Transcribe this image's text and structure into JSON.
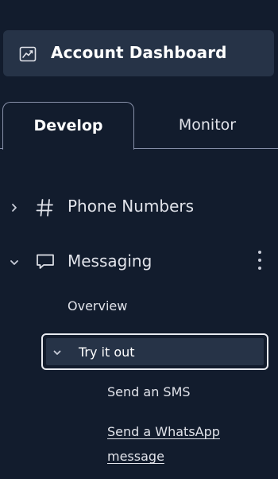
{
  "header": {
    "dashboard_label": "Account Dashboard",
    "dashboard_icon": "chart-line-icon"
  },
  "tabs": [
    {
      "label": "Develop",
      "active": true
    },
    {
      "label": "Monitor",
      "active": false
    }
  ],
  "nav": {
    "items": [
      {
        "label": "Phone Numbers",
        "icon": "hash-icon",
        "expanded": false
      },
      {
        "label": "Messaging",
        "icon": "chat-bubble-icon",
        "expanded": true
      }
    ],
    "messaging": {
      "overview_label": "Overview",
      "try_it_out": {
        "label": "Try it out",
        "expanded": true,
        "children": [
          {
            "label": "Send an SMS"
          },
          {
            "label_line1": "Send a WhatsApp",
            "label_line2": "message"
          }
        ]
      }
    }
  },
  "colors": {
    "background": "#121c2d",
    "panel": "#263347",
    "text": "#e1e3ea",
    "border": "#8891aa",
    "focus_ring": "#e8eaf0"
  }
}
